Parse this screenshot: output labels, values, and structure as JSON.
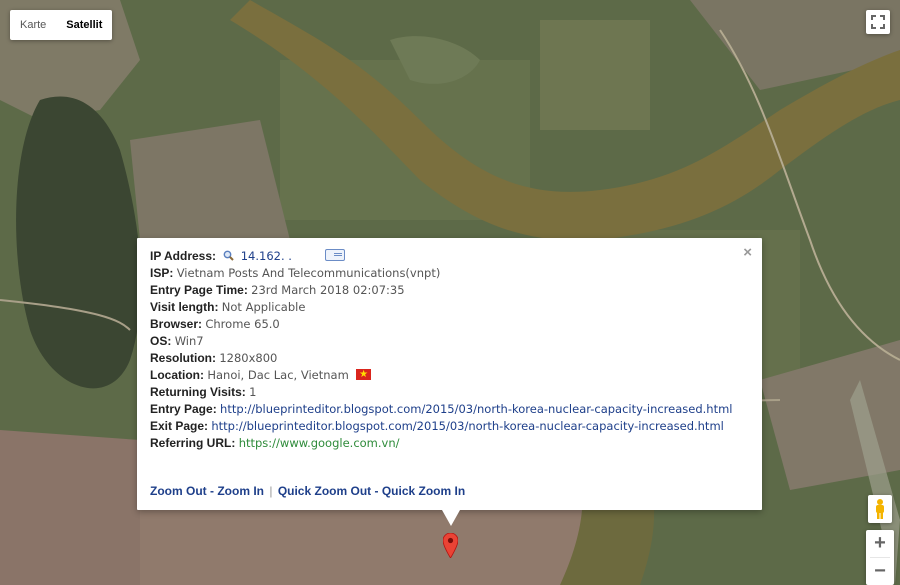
{
  "map": {
    "type_options": [
      "Karte",
      "Satellit"
    ],
    "active_type": "Satellit",
    "zoom_in_label": "+",
    "zoom_out_label": "−"
  },
  "info": {
    "close_label": "×",
    "ip": {
      "key": "IP Address:",
      "value": "14.162.     ."
    },
    "isp": {
      "key": "ISP:",
      "value": "Vietnam Posts And Telecommunications(vnpt)"
    },
    "entry_time": {
      "key": "Entry Page Time:",
      "value": "23rd March 2018 02:07:35"
    },
    "visit_length": {
      "key": "Visit length:",
      "value": "Not Applicable"
    },
    "browser": {
      "key": "Browser:",
      "value": "Chrome 65.0"
    },
    "os": {
      "key": "OS:",
      "value": "Win7"
    },
    "resolution": {
      "key": "Resolution:",
      "value": "1280x800"
    },
    "location": {
      "key": "Location:",
      "value": "Hanoi, Dac Lac, Vietnam"
    },
    "returning": {
      "key": "Returning Visits:",
      "value": "1"
    },
    "entry_page": {
      "key": "Entry Page:",
      "value": "http://blueprinteditor.blogspot.com/2015/03/north-korea-nuclear-capacity-increased.html"
    },
    "exit_page": {
      "key": "Exit Page:",
      "value": "http://blueprinteditor.blogspot.com/2015/03/north-korea-nuclear-capacity-increased.html"
    },
    "referring": {
      "key": "Referring URL:",
      "value": "https://www.google.com.vn/"
    },
    "links": {
      "zoom_out": "Zoom Out",
      "dash1": " - ",
      "zoom_in": "Zoom In",
      "bar": "|",
      "quick_zoom_out": "Quick Zoom Out",
      "dash2": " - ",
      "quick_zoom_in": "Quick Zoom In"
    }
  },
  "colors": {
    "land": "#5d6a48",
    "urban": "#8a7468",
    "river": "#7a6f3e",
    "lake": "#3b4632",
    "link": "#1e3f8a",
    "referrer": "#2e8b3a",
    "marker": "#ea4335"
  },
  "icons": [
    "fullscreen-icon",
    "pegman-icon",
    "magnifier-icon",
    "id-card-icon",
    "vietnam-flag-icon",
    "map-marker-icon",
    "close-icon"
  ]
}
